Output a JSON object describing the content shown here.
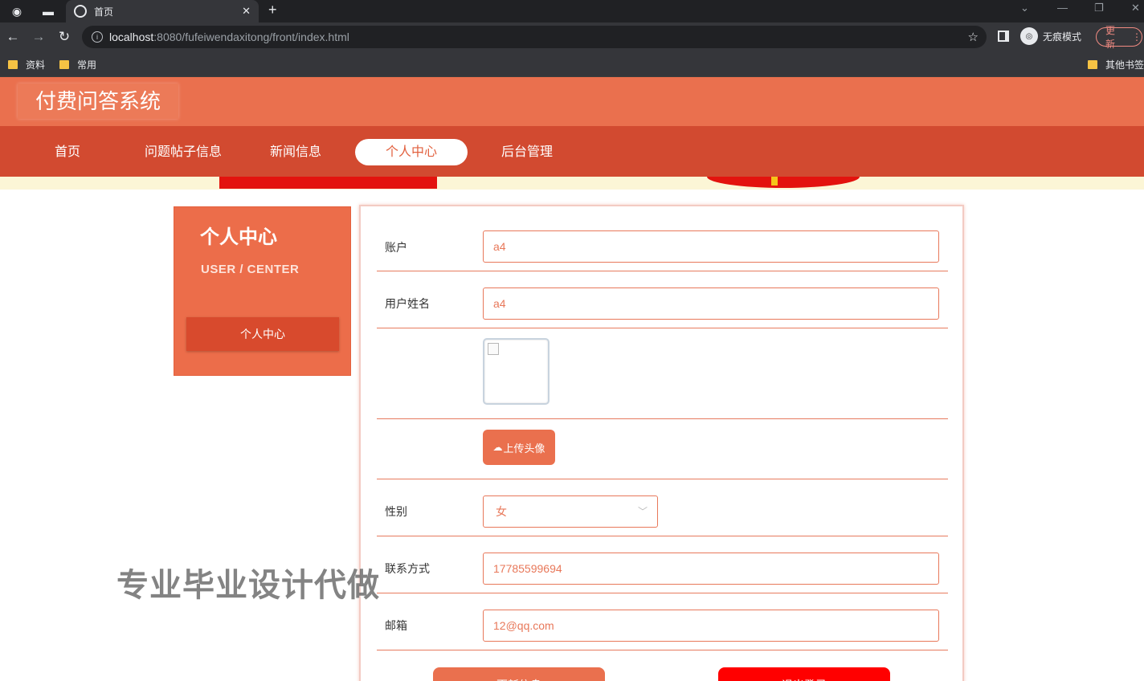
{
  "browser": {
    "tab_title": "首页",
    "url_host": "localhost",
    "url_path": ":8080/fufeiwendaxitong/front/index.html",
    "incognito_label": "无痕模式",
    "update_label": "更新",
    "bookmarks": [
      "资料",
      "常用"
    ],
    "other_bookmarks": "其他书签",
    "icons": [
      "globe-icon",
      "back-icon",
      "forward-icon",
      "reload-icon",
      "info-icon",
      "star-icon",
      "close-icon",
      "new-tab-icon",
      "menu-icon"
    ]
  },
  "site": {
    "title": "付费问答系统",
    "nav": [
      {
        "label": "首页"
      },
      {
        "label": "问题帖子信息"
      },
      {
        "label": "新闻信息"
      },
      {
        "label": "个人中心",
        "active": true
      },
      {
        "label": "后台管理"
      }
    ],
    "accent_color": "#ea704e",
    "nav_color": "#d24a30"
  },
  "sidebar": {
    "title": "个人中心",
    "subtitle": "USER / CENTER",
    "items": [
      {
        "label": "个人中心"
      }
    ]
  },
  "form": {
    "account_label": "账户",
    "account_value": "a4",
    "name_label": "用户姓名",
    "name_value": "a4",
    "upload_label": "上传头像",
    "gender_label": "性别",
    "gender_value": "女",
    "phone_label": "联系方式",
    "phone_value": "17785599694",
    "email_label": "邮箱",
    "email_value": "12@qq.com",
    "update_button": "更新信息",
    "logout_button": "退出登录"
  },
  "watermark": "专业毕业设计代做"
}
